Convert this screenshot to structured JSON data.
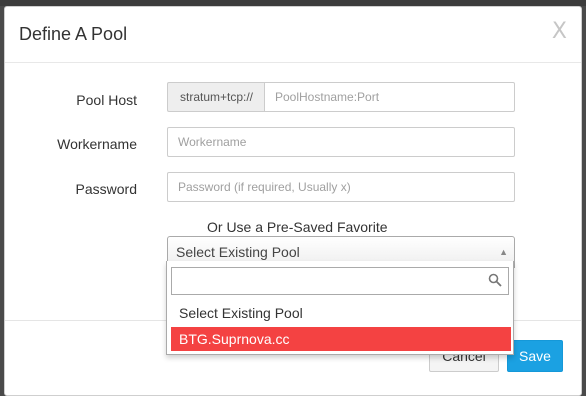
{
  "modal": {
    "title": "Define A Pool",
    "close_glyph": "X"
  },
  "form": {
    "pool_host": {
      "label": "Pool Host",
      "prefix": "stratum+tcp://",
      "placeholder": "PoolHostname:Port",
      "value": ""
    },
    "workername": {
      "label": "Workername",
      "placeholder": "Workername",
      "value": ""
    },
    "password": {
      "label": "Password",
      "placeholder": "Password (if required, Usually x)",
      "value": ""
    },
    "favorite": {
      "heading": "Or Use a Pre-Saved Favorite",
      "selected": "Select Existing Pool",
      "search_value": "",
      "options": [
        "Select Existing Pool",
        "BTG.Suprnova.cc"
      ],
      "highlighted_option": "BTG.Suprnova.cc"
    }
  },
  "footer": {
    "cancel_label": "Cancel",
    "save_label": "Save"
  },
  "colors": {
    "save_button": "#1ba1e2",
    "highlight": "#f44242"
  }
}
